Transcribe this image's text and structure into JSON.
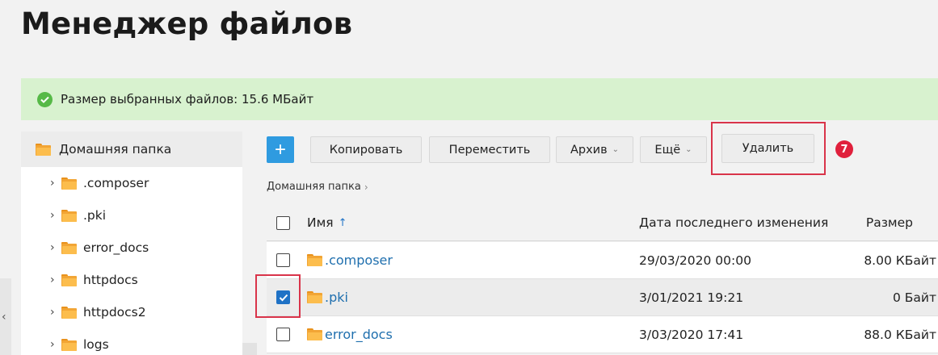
{
  "page": {
    "title": "Менеджер файлов"
  },
  "banner": {
    "message": "Размер выбранных файлов: 15.6 МБайт"
  },
  "tree": {
    "root": {
      "label": "Домашняя папка"
    },
    "items": [
      {
        "label": ".composer"
      },
      {
        "label": ".pki"
      },
      {
        "label": "error_docs"
      },
      {
        "label": "httpdocs"
      },
      {
        "label": "httpdocs2"
      },
      {
        "label": "logs"
      }
    ]
  },
  "toolbar": {
    "add_label": "+",
    "copy_label": "Копировать",
    "move_label": "Переместить",
    "archive_label": "Архив",
    "more_label": "Ещё",
    "delete_label": "Удалить",
    "step_number": "7"
  },
  "breadcrumb": {
    "current": "Домашняя папка"
  },
  "table": {
    "headers": {
      "name": "Имя",
      "sort_indicator": "↑",
      "date": "Дата последнего изменения",
      "size": "Размер"
    },
    "rows": [
      {
        "name": ".composer",
        "date": "29/03/2020 00:00",
        "size": "8.00 КБайт",
        "checked": false
      },
      {
        "name": ".pki",
        "date": "3/01/2021 19:21",
        "size": "0 Байт",
        "checked": true
      },
      {
        "name": "error_docs",
        "date": "3/03/2020 17:41",
        "size": "88.0 КБайт",
        "checked": false
      }
    ]
  },
  "colors": {
    "accent": "#2f9be0",
    "highlight": "#d9344a",
    "banner_bg": "#d8f2cf",
    "link": "#1f6fae"
  }
}
